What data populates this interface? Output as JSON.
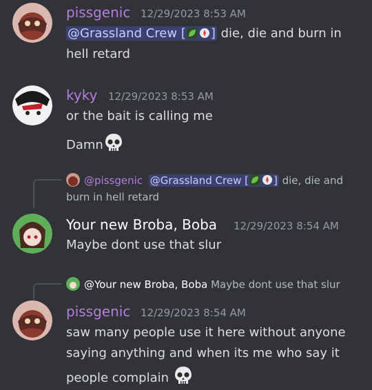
{
  "messages": [
    {
      "author": "pissgenic",
      "author_color": "#b57edc",
      "timestamp": "12/29/2023 8:53 AM",
      "mention": "@Grassland Crew [",
      "mention_close": "]",
      "line1_rest": " die, die and burn in",
      "line2": "hell retard",
      "avatar_icon": "pissgenic-avatar"
    },
    {
      "author": "kyky",
      "author_color": "#b57edc",
      "timestamp": "12/29/2023 8:53 AM",
      "line1": "or the bait is calling me",
      "line2": "Damn",
      "avatar_icon": "kyky-avatar"
    },
    {
      "reply": {
        "author": "@pissgenic",
        "mention": "@Grassland Crew [",
        "mention_close": "]",
        "text1": " die, die and",
        "text2": "burn in hell retard"
      },
      "author": "Your new Broba, Boba",
      "author_color": "#ffffff",
      "timestamp": "12/29/2023 8:54 AM",
      "line1": "Maybe dont use that slur",
      "avatar_icon": "boba-avatar"
    },
    {
      "reply": {
        "author": "@Your new Broba, Boba",
        "text": "Maybe dont use that slur"
      },
      "author": "pissgenic",
      "author_color": "#b57edc",
      "timestamp": "12/29/2023 8:54 AM",
      "line1": "saw many people use it here without anyone",
      "line2": "saying anything and when its me who say it",
      "line3": "people complain",
      "avatar_icon": "pissgenic-avatar"
    }
  ]
}
